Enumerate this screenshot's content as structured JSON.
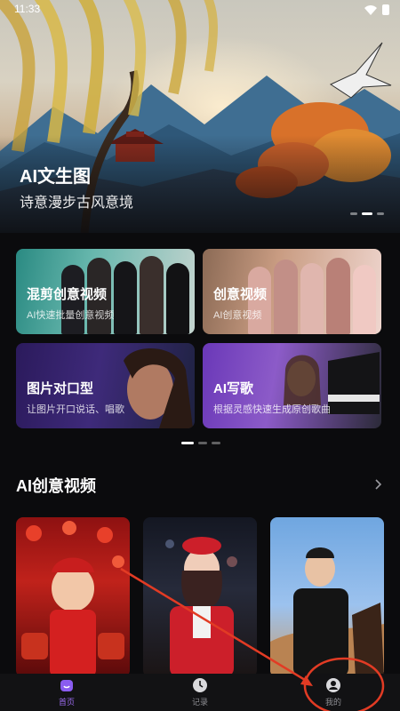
{
  "status_bar": {
    "time": "11:33"
  },
  "hero": {
    "title": "AI文生图",
    "subtitle": "诗意漫步古风意境",
    "slide_count": 3,
    "active_slide": 2
  },
  "features": [
    {
      "title": "混剪创意视频",
      "subtitle": "AI快速批量创意视频"
    },
    {
      "title": "创意视频",
      "subtitle": "AI创意视频"
    },
    {
      "title": "图片对口型",
      "subtitle": "让图片开口说话、唱歌"
    },
    {
      "title": "AI写歌",
      "subtitle": "根据灵感快速生成原创歌曲"
    }
  ],
  "features_pager": {
    "page_count": 3,
    "active_page": 1
  },
  "section": {
    "title": "AI创意视频",
    "more_icon": "chevron-right-icon"
  },
  "bottom_nav": [
    {
      "label": "首页",
      "icon": "home-icon",
      "active": true
    },
    {
      "label": "记录",
      "icon": "clock-icon",
      "active": false
    },
    {
      "label": "我的",
      "icon": "user-icon",
      "active": false
    }
  ],
  "colors": {
    "accent": "#9c6cf0",
    "annotation": "#e23b24",
    "background": "#0b0b0d"
  }
}
